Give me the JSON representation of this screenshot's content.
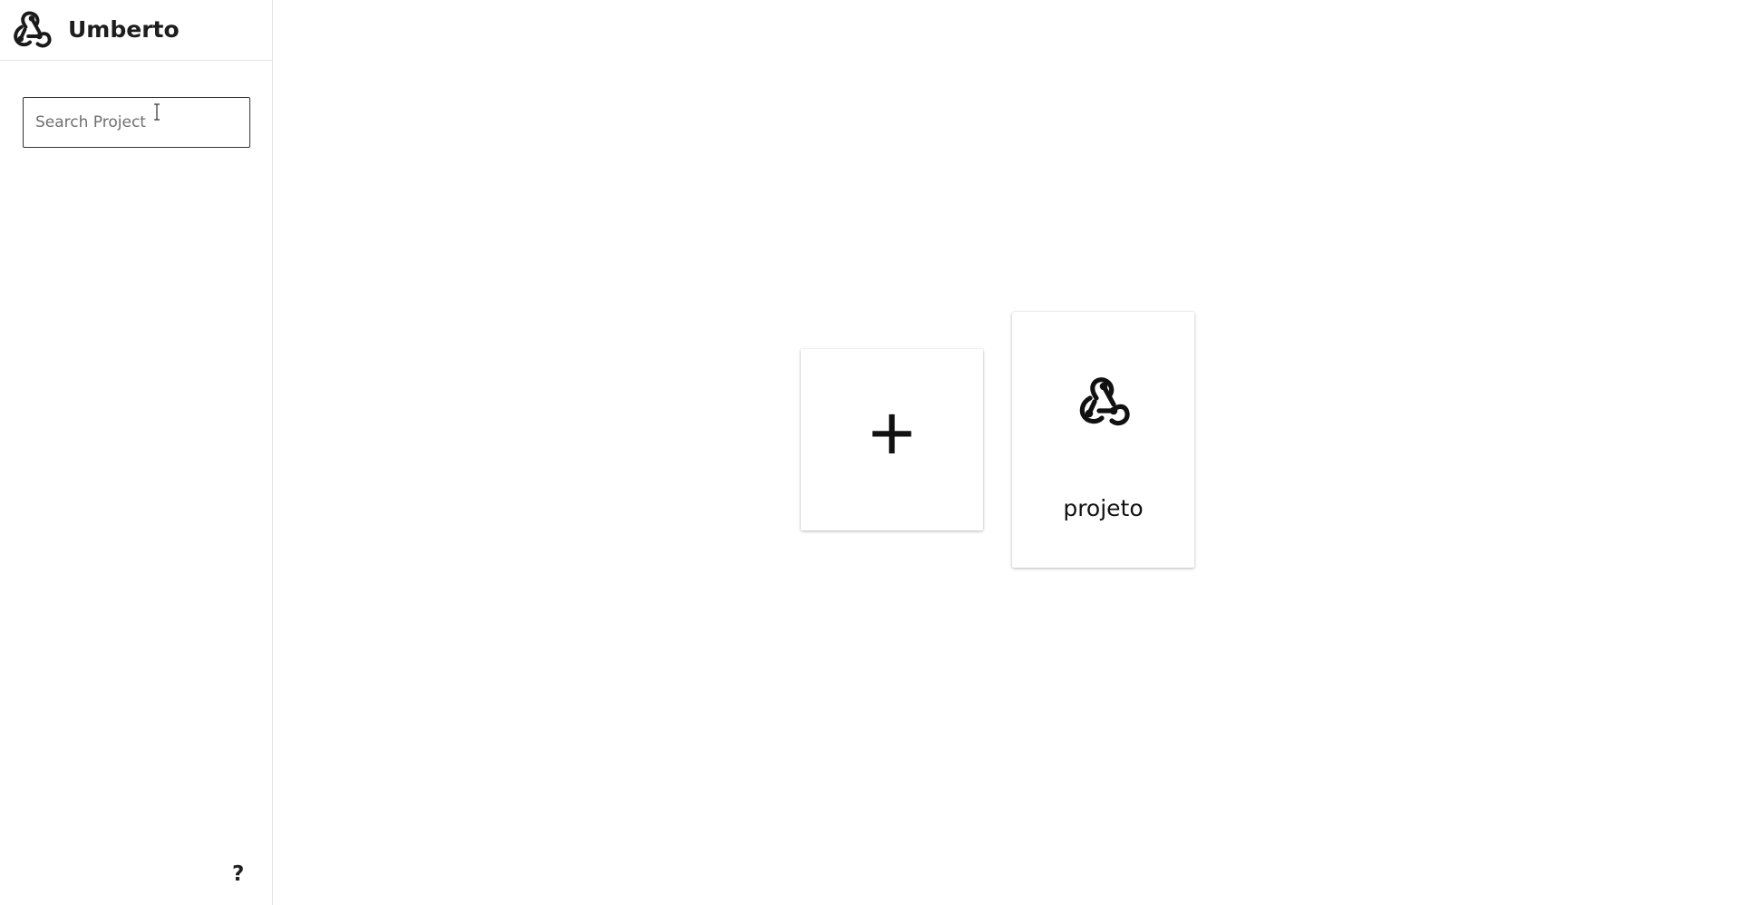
{
  "app": {
    "title": "Umberto",
    "logo_icon": "webhook-icon"
  },
  "sidebar": {
    "search": {
      "placeholder": "Search Project",
      "value": ""
    },
    "help_label": "?"
  },
  "main": {
    "new_project": {
      "label": "+",
      "icon": "plus-icon"
    },
    "projects": [
      {
        "name": "projeto",
        "icon": "webhook-icon"
      }
    ]
  }
}
